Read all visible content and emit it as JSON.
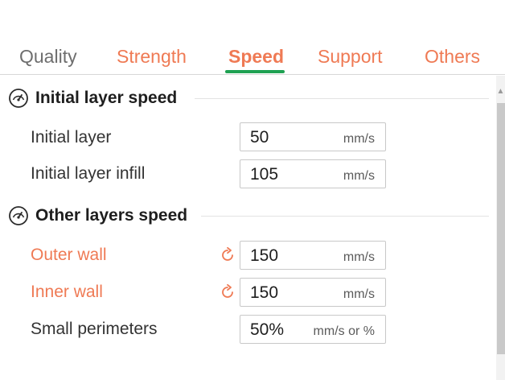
{
  "tabs": [
    {
      "label": "Quality",
      "state": "inactive"
    },
    {
      "label": "Strength",
      "state": "accent"
    },
    {
      "label": "Speed",
      "state": "selected"
    },
    {
      "label": "Support",
      "state": "accent"
    },
    {
      "label": "Others",
      "state": "accent"
    }
  ],
  "colors": {
    "accent_orange": "#ef7a54",
    "selected_underline_green": "#1fa152",
    "text_dark": "#1e1e1e",
    "text_gray": "#6e6e6e"
  },
  "sections": [
    {
      "title": "Initial layer speed",
      "icon": "speedometer-icon",
      "rows": [
        {
          "label": "Initial layer",
          "value": "50",
          "unit": "mm/s",
          "modified": false
        },
        {
          "label": "Initial layer infill",
          "value": "105",
          "unit": "mm/s",
          "modified": false
        }
      ]
    },
    {
      "title": "Other layers speed",
      "icon": "speedometer-icon",
      "rows": [
        {
          "label": "Outer wall",
          "value": "150",
          "unit": "mm/s",
          "modified": true,
          "reset_icon": "reset-icon"
        },
        {
          "label": "Inner wall",
          "value": "150",
          "unit": "mm/s",
          "modified": true,
          "reset_icon": "reset-icon"
        },
        {
          "label": "Small perimeters",
          "value": "50%",
          "unit": "mm/s or %",
          "modified": false
        }
      ]
    }
  ]
}
